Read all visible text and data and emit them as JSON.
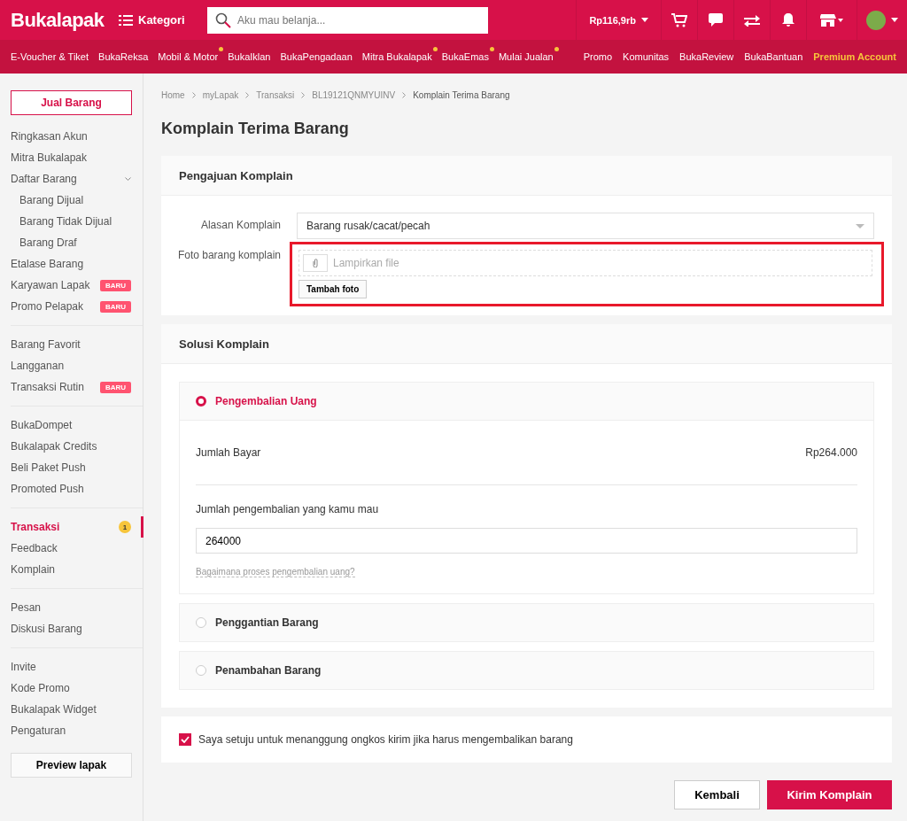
{
  "header": {
    "logo": "Bukalapak",
    "category_button": "Kategori",
    "search": {
      "placeholder": "Aku mau belanja..."
    },
    "balance": "Rp116,9rb"
  },
  "subnav": {
    "left": [
      {
        "label": "E-Voucher & Tiket",
        "new": false
      },
      {
        "label": "BukaReksa",
        "new": false
      },
      {
        "label": "Mobil & Motor",
        "new": true
      },
      {
        "label": "BukaIklan",
        "new": false
      },
      {
        "label": "BukaPengadaan",
        "new": false
      },
      {
        "label": "Mitra Bukalapak",
        "new": true
      },
      {
        "label": "BukaEmas",
        "new": true
      },
      {
        "label": "Mulai Jualan",
        "new": true
      }
    ],
    "right": [
      {
        "label": "Promo",
        "kind": "link"
      },
      {
        "label": "Komunitas",
        "kind": "link"
      },
      {
        "label": "BukaReview",
        "kind": "link"
      },
      {
        "label": "BukaBantuan",
        "kind": "link"
      },
      {
        "label": "Premium Account",
        "kind": "premium"
      }
    ]
  },
  "sidebar": {
    "sell_button": "Jual Barang",
    "groups": [
      [
        {
          "label": "Ringkasan Akun",
          "selected": false
        },
        {
          "label": "Mitra Bukalapak",
          "selected": false
        },
        {
          "label": "Daftar Barang",
          "selected": false,
          "expanded": true,
          "children": [
            {
              "label": "Barang Dijual",
              "selected": false
            },
            {
              "label": "Barang Tidak Dijual",
              "selected": false
            },
            {
              "label": "Barang Draf",
              "selected": false
            }
          ]
        },
        {
          "label": "Etalase Barang",
          "selected": false
        },
        {
          "label": "Karyawan Lapak",
          "selected": false,
          "badge": "BARU"
        },
        {
          "label": "Promo Pelapak",
          "selected": false,
          "badge": "BARU"
        }
      ],
      [
        {
          "label": "Barang Favorit",
          "selected": false
        },
        {
          "label": "Langganan",
          "selected": false
        },
        {
          "label": "Transaksi Rutin",
          "selected": false,
          "badge": "BARU"
        }
      ],
      [
        {
          "label": "BukaDompet",
          "selected": false
        },
        {
          "label": "Bukalapak Credits",
          "selected": false
        },
        {
          "label": "Beli Paket Push",
          "selected": false
        },
        {
          "label": "Promoted Push",
          "selected": false
        }
      ],
      [
        {
          "label": "Transaksi",
          "selected": true,
          "count": "1"
        },
        {
          "label": "Feedback",
          "selected": false
        },
        {
          "label": "Komplain",
          "selected": false
        }
      ],
      [
        {
          "label": "Pesan",
          "selected": false
        },
        {
          "label": "Diskusi Barang",
          "selected": false
        }
      ],
      [
        {
          "label": "Invite",
          "selected": false
        },
        {
          "label": "Kode Promo",
          "selected": false
        },
        {
          "label": "Bukalapak Widget",
          "selected": false
        },
        {
          "label": "Pengaturan",
          "selected": false
        }
      ]
    ],
    "preview_button": "Preview lapak"
  },
  "breadcrumb": [
    "Home",
    "myLapak",
    "Transaksi",
    "BL19121QNMYUINV",
    "Komplain Terima Barang"
  ],
  "page_title": "Komplain Terima Barang",
  "complaint": {
    "title": "Pengajuan Komplain",
    "reason_label": "Alasan Komplain",
    "reason_value": "Barang rusak/cacat/pecah",
    "photo_label": "Foto barang komplain",
    "file_placeholder": "Lampirkan file",
    "add_photo_button": "Tambah foto",
    "highlighted": true
  },
  "solution": {
    "title": "Solusi Komplain",
    "options": [
      {
        "label": "Pengembalian Uang",
        "selected": true
      },
      {
        "label": "Penggantian Barang",
        "selected": false
      },
      {
        "label": "Penambahan Barang",
        "selected": false
      }
    ],
    "refund": {
      "paid_label": "Jumlah Bayar",
      "paid_value": "Rp264.000",
      "amount_label": "Jumlah pengembalian yang kamu mau",
      "amount_value": "264000",
      "help_link": "Bagaimana proses pengembalian uang?"
    }
  },
  "agreement": {
    "text": "Saya setuju untuk menanggung ongkos kirim jika harus mengembalikan barang",
    "checked": true
  },
  "buttons": [
    {
      "label": "Kembali",
      "kind": "secondary"
    },
    {
      "label": "Kirim Komplain",
      "kind": "primary"
    }
  ]
}
